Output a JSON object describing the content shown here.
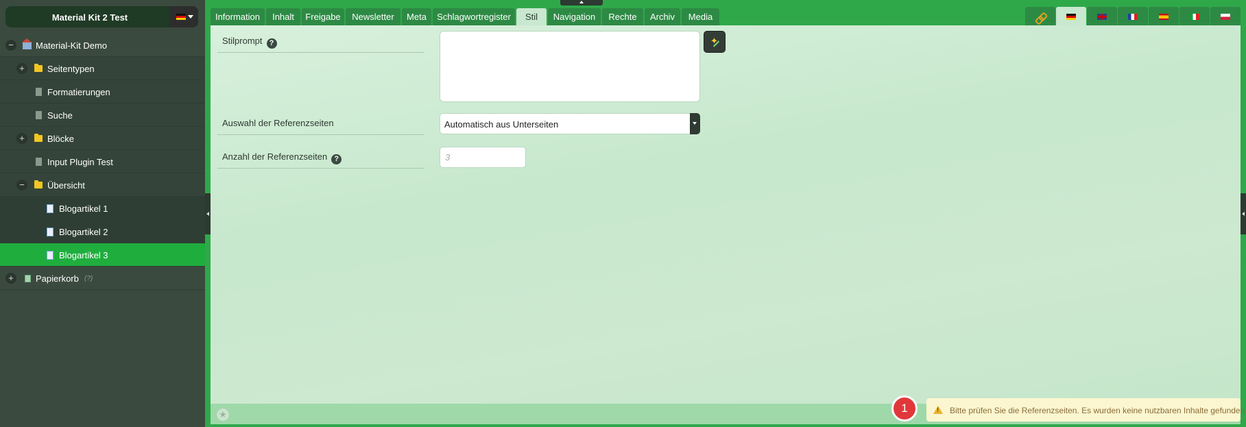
{
  "site": {
    "title": "Material Kit 2 Test",
    "language_icon": "flag-de"
  },
  "tree": [
    {
      "label": "Material-Kit Demo",
      "icon": "home-icon",
      "toggle": "−"
    },
    {
      "label": "Seitentypen",
      "icon": "folder-icon",
      "toggle": "+"
    },
    {
      "label": "Formatierungen",
      "icon": "page-icon"
    },
    {
      "label": "Suche",
      "icon": "page-icon"
    },
    {
      "label": "Blöcke",
      "icon": "folder-icon",
      "toggle": "+"
    },
    {
      "label": "Input Plugin Test",
      "icon": "page-icon"
    },
    {
      "label": "Übersicht",
      "icon": "folder-icon",
      "toggle": "−"
    },
    {
      "label": "Blogartikel 1",
      "icon": "page-icon"
    },
    {
      "label": "Blogartikel 2",
      "icon": "page-icon"
    },
    {
      "label": "Blogartikel 3",
      "icon": "page-icon",
      "active": true
    },
    {
      "label": "Papierkorb",
      "icon": "trash-icon",
      "toggle": "+",
      "note": "(?)"
    }
  ],
  "tabs": [
    "Information",
    "Inhalt",
    "Freigabe",
    "Newsletter",
    "Meta",
    "Schlagwortregister",
    "Stil",
    "Navigation",
    "Rechte",
    "Archiv",
    "Media"
  ],
  "active_tab": "Stil",
  "language_tabs": [
    "link-icon",
    "flag-de",
    "flag-gb",
    "flag-fr",
    "flag-es",
    "flag-it",
    "flag-pl"
  ],
  "active_language": "flag-de",
  "form": {
    "style_prompt_label": "Stilprompt",
    "style_prompt_value": "",
    "help_glyph": "?",
    "reference_pages_label": "Auswahl der Referenzseiten",
    "reference_pages_value": "Automatisch aus Unterseiten",
    "reference_count_label": "Anzahl der Referenzseiten",
    "reference_count_placeholder": "3"
  },
  "footer": {
    "message_count": "1",
    "notice": "Bitte prüfen Sie die Referenzseiten. Es wurden keine nutzbaren Inhalte gefunden.",
    "star_glyph": "★"
  }
}
